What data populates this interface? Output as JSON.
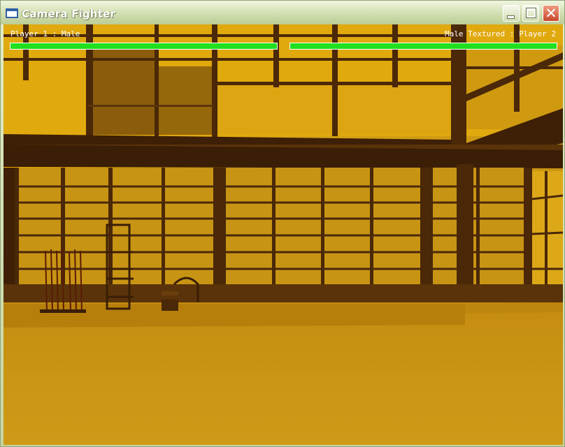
{
  "window": {
    "title": "Camera Fighter"
  },
  "hud": {
    "player1": {
      "label": "Player 1 : Male",
      "health": 1.0
    },
    "player2": {
      "label": "Male Textured : Player 2",
      "health": 1.0
    }
  },
  "colors": {
    "health": "#20e020",
    "scene_wood": "#4a2808",
    "scene_wall": "#d2a012"
  }
}
